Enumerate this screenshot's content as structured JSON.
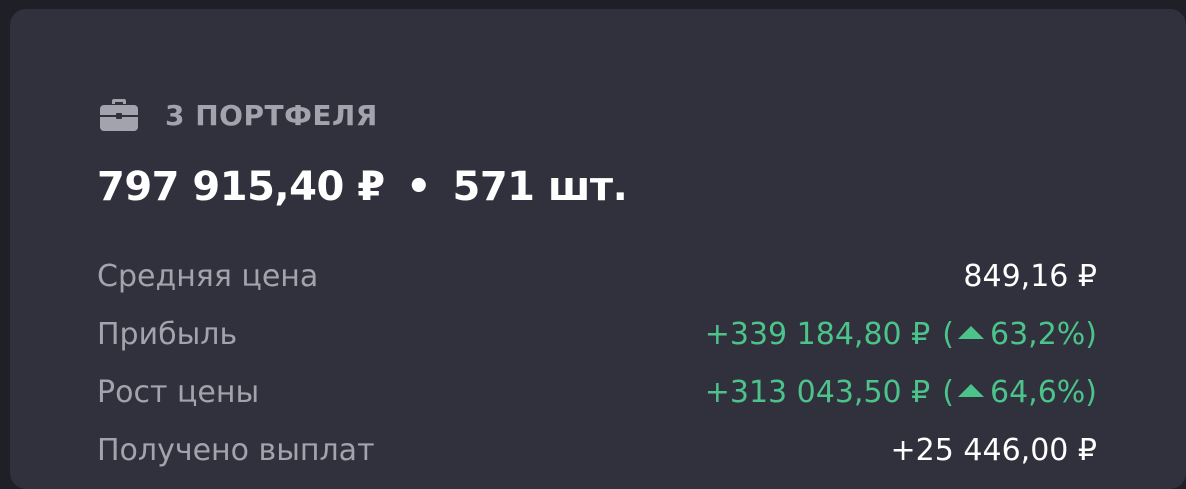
{
  "header": {
    "icon": "briefcase-icon",
    "portfolio_count": "3 ПОРТФЕЛЯ"
  },
  "summary": {
    "total_value": "797 915,40 ₽",
    "separator": "•",
    "quantity": "571 шт."
  },
  "stats": {
    "avg_price": {
      "label": "Средняя цена",
      "value": "849,16 ₽"
    },
    "profit": {
      "label": "Прибыль",
      "value": "+339 184,80 ₽",
      "paren_open": "(",
      "percent": "63,2%)"
    },
    "price_growth": {
      "label": "Рост цены",
      "value": "+313 043,50 ₽",
      "paren_open": "(",
      "percent": "64,6%)"
    },
    "payouts": {
      "label": "Получено выплат",
      "value": "+25 446,00 ₽"
    }
  },
  "colors": {
    "background": "#1f1f27",
    "card": "#31313d",
    "muted_text": "#a3a3ad",
    "positive": "#4cc38a",
    "primary_text": "#ffffff"
  }
}
